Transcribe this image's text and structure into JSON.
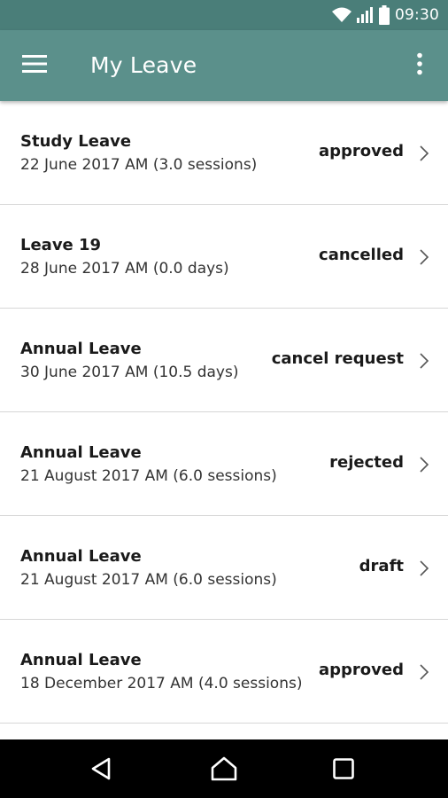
{
  "status_bar": {
    "time": "09:30",
    "icons": [
      "wifi-icon",
      "signal-icon",
      "battery-icon"
    ]
  },
  "app_bar": {
    "title": "My Leave",
    "menu_icon": "hamburger-menu-icon",
    "overflow_icon": "more-vert-icon"
  },
  "leave_list": {
    "items": [
      {
        "type": "Study Leave",
        "date": "22 June 2017 AM (3.0 sessions)",
        "status": "approved"
      },
      {
        "type": "Leave 19",
        "date": "28 June 2017 AM (0.0 days)",
        "status": "cancelled"
      },
      {
        "type": "Annual Leave",
        "date": "30 June 2017 AM (10.5 days)",
        "status": "cancel request"
      },
      {
        "type": "Annual Leave",
        "date": "21 August 2017 AM (6.0 sessions)",
        "status": "rejected"
      },
      {
        "type": "Annual Leave",
        "date": "21 August 2017 AM (6.0 sessions)",
        "status": "draft"
      },
      {
        "type": "Annual Leave",
        "date": "18 December 2017 AM (4.0 sessions)",
        "status": "approved"
      }
    ]
  },
  "nav_bar": {
    "buttons": [
      "back-icon",
      "home-icon",
      "recents-icon"
    ]
  },
  "colors": {
    "status_bar": "#4a7e79",
    "app_bar": "#5b908b",
    "divider": "#d6d6d6",
    "nav_bar": "#000000"
  }
}
